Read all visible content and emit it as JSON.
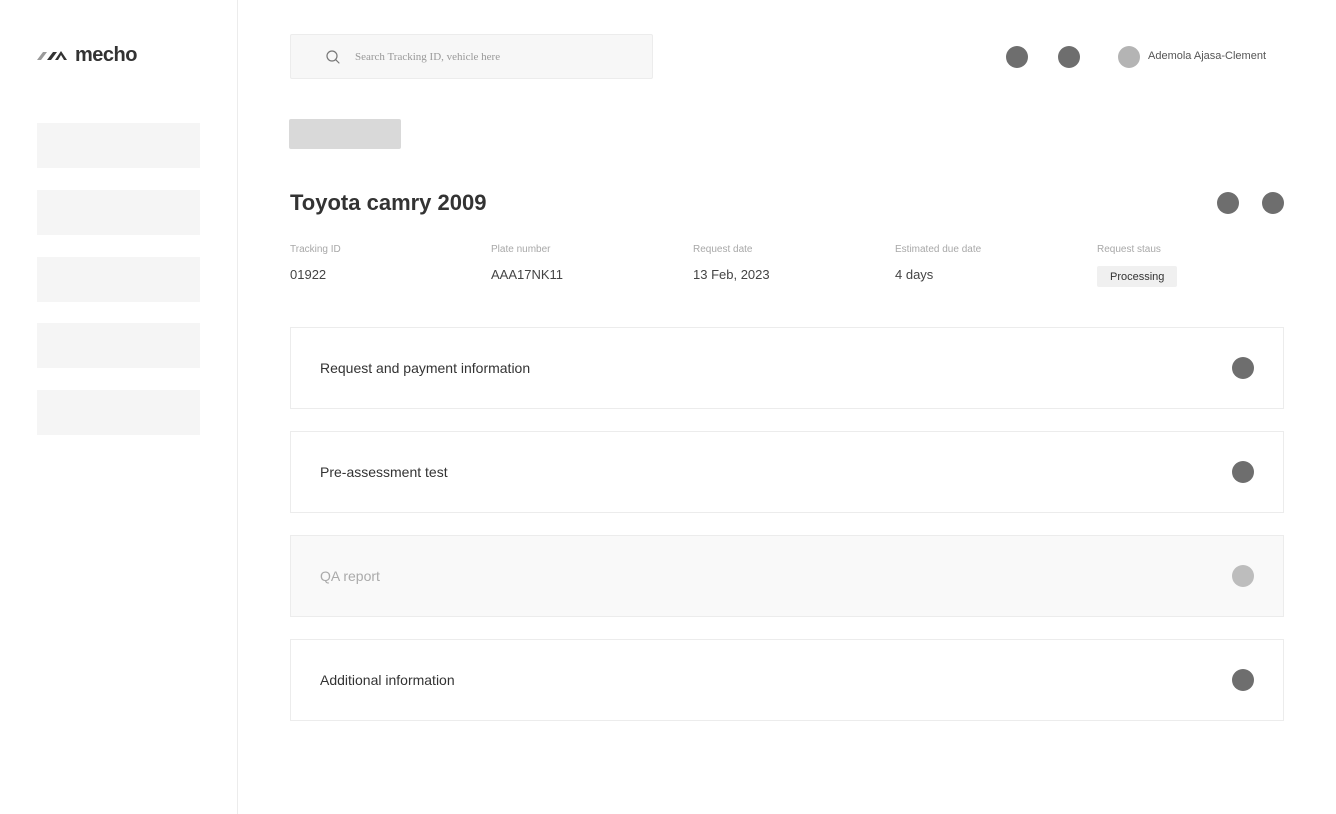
{
  "brand": {
    "name": "mecho"
  },
  "sidebar": {
    "items": [
      {},
      {},
      {},
      {},
      {}
    ]
  },
  "header": {
    "search_placeholder": "Search Tracking ID, vehicle here",
    "user_name": "Ademola Ajasa-Clement"
  },
  "vehicle": {
    "title": "Toyota camry 2009",
    "fields": [
      {
        "label": "Tracking ID",
        "value": "01922"
      },
      {
        "label": "Plate number",
        "value": "AAA17NK11"
      },
      {
        "label": "Request date",
        "value": "13 Feb, 2023"
      },
      {
        "label": "Estimated due date",
        "value": "4 days"
      },
      {
        "label": "Request staus",
        "value": "Processing"
      }
    ]
  },
  "sections": [
    {
      "title": "Request and payment information",
      "enabled": true
    },
    {
      "title": "Pre-assessment test",
      "enabled": true
    },
    {
      "title": "QA report",
      "enabled": false
    },
    {
      "title": "Additional information",
      "enabled": true
    }
  ],
  "colors": {
    "icon_active": "#6e6e6e",
    "icon_disabled": "#bdbdbd",
    "placeholder_block": "#f5f5f5"
  }
}
